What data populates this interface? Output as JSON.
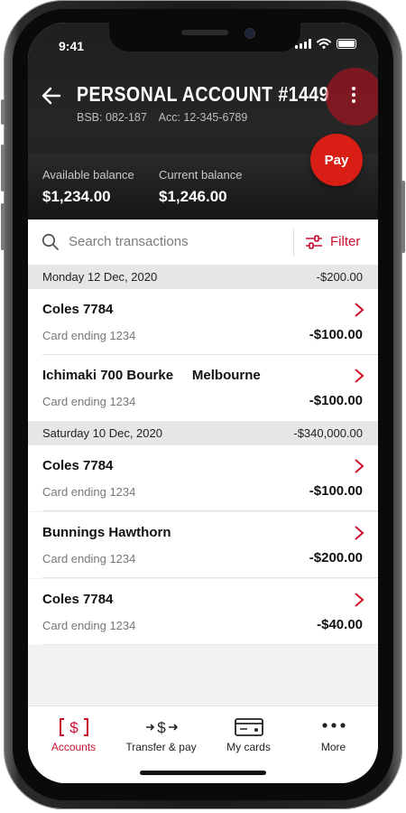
{
  "status_bar": {
    "time": "9:41"
  },
  "header": {
    "title": "PERSONAL ACCOUNT #1449",
    "bsb": "BSB: 082-187",
    "acc": "Acc: 12-345-6789",
    "pay_label": "Pay",
    "available_label": "Available balance",
    "available_value": "$1,234.00",
    "current_label": "Current balance",
    "current_value": "$1,246.00"
  },
  "search": {
    "placeholder": "Search transactions",
    "filter_label": "Filter"
  },
  "groups": [
    {
      "date": "Monday 12 Dec, 2020",
      "total": "-$200.00",
      "transactions": [
        {
          "merchant": "Coles 7784",
          "card": "Card ending 1234",
          "amount": "-$100.00"
        },
        {
          "merchant": "Ichimaki 700 Bourke     Melbourne",
          "card": "Card ending 1234",
          "amount": "-$100.00"
        }
      ]
    },
    {
      "date": "Saturday 10 Dec, 2020",
      "total": "-$340,000.00",
      "transactions": [
        {
          "merchant": "Coles 7784",
          "card": "Card ending 1234",
          "amount": "-$100.00"
        },
        {
          "merchant": "Bunnings Hawthorn",
          "card": "Card ending 1234",
          "amount": "-$200.00"
        },
        {
          "merchant": "Coles 7784",
          "card": "Card ending 1234",
          "amount": "-$40.00"
        }
      ]
    }
  ],
  "tabs": [
    {
      "label": "Accounts",
      "icon": "accounts-icon",
      "active": true
    },
    {
      "label": "Transfer & pay",
      "icon": "transfer-icon",
      "active": false
    },
    {
      "label": "My cards",
      "icon": "card-icon",
      "active": false
    },
    {
      "label": "More",
      "icon": "more-icon",
      "active": false
    }
  ],
  "colors": {
    "accent": "#c8102e",
    "pay_button": "#d81e15",
    "header_bg": "#232323"
  }
}
